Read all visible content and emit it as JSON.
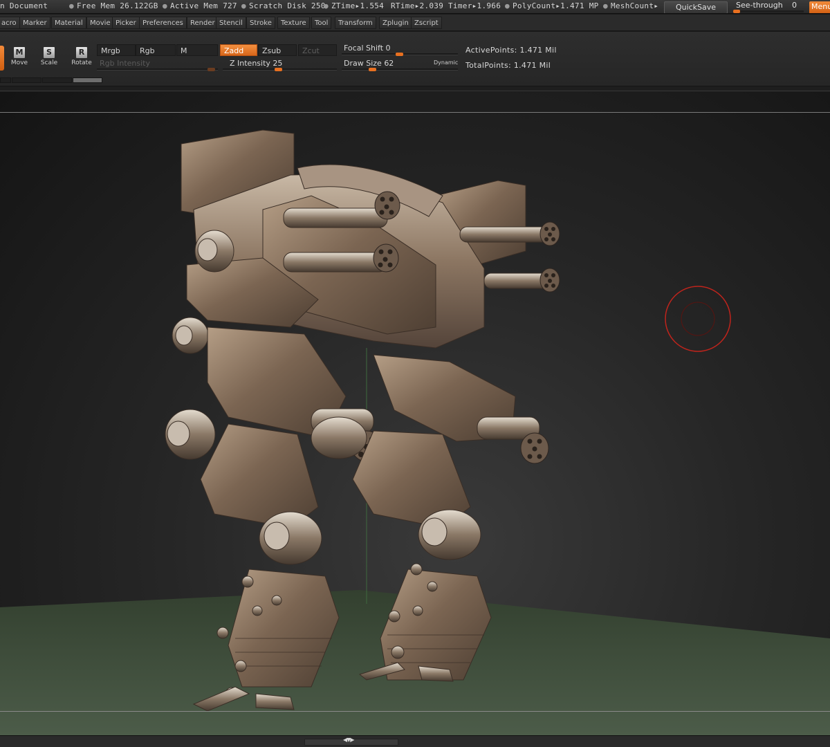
{
  "status": {
    "document": "n Document",
    "free_mem": "Free Mem 26.122GB",
    "active_mem": "Active Mem 727",
    "scratch_disk": "Scratch Disk 250",
    "ztime": "ZTime▸1.554",
    "rtime": "RTime▸2.039",
    "timer": "Timer▸1.966",
    "polycount": "PolyCount▸1.471  MP",
    "meshcount": "MeshCount▸",
    "quicksave_label": "QuickSave",
    "seethrough_label": "See-through",
    "seethrough_value": 0,
    "seethrough_value_text": "0",
    "menus_label": "Menus"
  },
  "menu": {
    "items": [
      "acro",
      "Marker",
      "Material",
      "Movie",
      "Picker",
      "Preferences",
      "Render",
      "Stencil",
      "Stroke",
      "Texture",
      "Tool",
      "Transform",
      "Zplugin",
      "Zscript"
    ]
  },
  "shelf": {
    "tools": [
      {
        "letter": "M",
        "label": "Move"
      },
      {
        "letter": "S",
        "label": "Scale"
      },
      {
        "letter": "R",
        "label": "Rotate"
      }
    ],
    "mrgb": "Mrgb",
    "rgb": "Rgb",
    "m": "M",
    "zadd": "Zadd",
    "zsub": "Zsub",
    "zcut": "Zcut",
    "rgb_intensity_label": "Rgb Intensity",
    "z_intensity_label": "Z Intensity",
    "z_intensity_value": 25,
    "z_intensity_text": "25",
    "focal_shift_label": "Focal Shift",
    "focal_shift_value": 0,
    "focal_shift_text": "0",
    "draw_size_label": "Draw Size",
    "draw_size_value": 62,
    "draw_size_text": "62",
    "dynamic_label": "Dynamic",
    "active_points": "ActivePoints: 1.471  Mil",
    "total_points": "TotalPoints: 1.471  Mil"
  },
  "colors": {
    "accent": "#e87020",
    "brush_cursor": "#c0241c",
    "floor": "#3c4a3c",
    "metal": "#8a7460"
  }
}
